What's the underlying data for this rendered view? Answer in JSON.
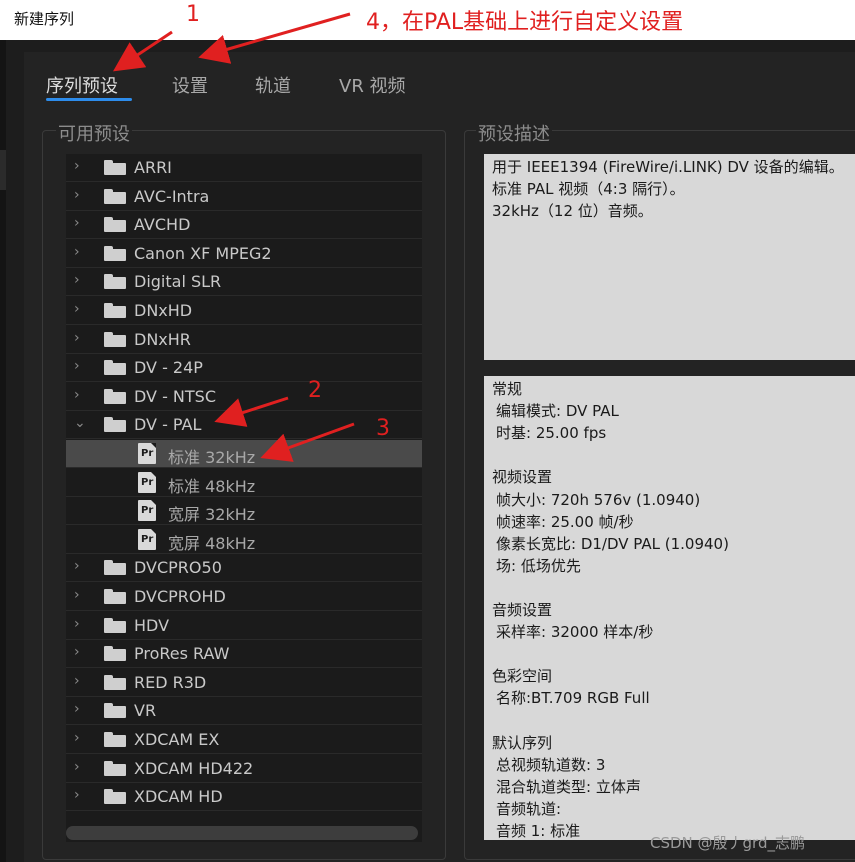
{
  "window": {
    "title": "新建序列"
  },
  "tabs": [
    {
      "label": "序列预设",
      "active": true
    },
    {
      "label": "设置",
      "active": false
    },
    {
      "label": "轨道",
      "active": false
    },
    {
      "label": "VR 视频",
      "active": false
    }
  ],
  "presets": {
    "section_label": "可用预设",
    "rows": [
      {
        "label": "ARRI",
        "type": "folder",
        "expanded": false
      },
      {
        "label": "AVC-Intra",
        "type": "folder",
        "expanded": false
      },
      {
        "label": "AVCHD",
        "type": "folder",
        "expanded": false
      },
      {
        "label": "Canon XF MPEG2",
        "type": "folder",
        "expanded": false
      },
      {
        "label": "Digital SLR",
        "type": "folder",
        "expanded": false
      },
      {
        "label": "DNxHD",
        "type": "folder",
        "expanded": false
      },
      {
        "label": "DNxHR",
        "type": "folder",
        "expanded": false
      },
      {
        "label": "DV - 24P",
        "type": "folder",
        "expanded": false
      },
      {
        "label": "DV - NTSC",
        "type": "folder",
        "expanded": false
      },
      {
        "label": "DV - PAL",
        "type": "folder",
        "expanded": true
      },
      {
        "label": "标准 32kHz",
        "type": "preset",
        "selected": true
      },
      {
        "label": "标准 48kHz",
        "type": "preset"
      },
      {
        "label": "宽屏 32kHz",
        "type": "preset"
      },
      {
        "label": "宽屏 48kHz",
        "type": "preset"
      },
      {
        "label": "DVCPRO50",
        "type": "folder",
        "expanded": false
      },
      {
        "label": "DVCPROHD",
        "type": "folder",
        "expanded": false
      },
      {
        "label": "HDV",
        "type": "folder",
        "expanded": false
      },
      {
        "label": "ProRes RAW",
        "type": "folder",
        "expanded": false
      },
      {
        "label": "RED R3D",
        "type": "folder",
        "expanded": false
      },
      {
        "label": "VR",
        "type": "folder",
        "expanded": false
      },
      {
        "label": "XDCAM EX",
        "type": "folder",
        "expanded": false
      },
      {
        "label": "XDCAM HD422",
        "type": "folder",
        "expanded": false
      },
      {
        "label": "XDCAM HD",
        "type": "folder",
        "expanded": false
      }
    ],
    "preset_icon_text": "Pr"
  },
  "description": {
    "section_label": "预设描述",
    "lines": [
      "用于 IEEE1394 (FireWire/i.LINK) DV 设备的编辑。",
      "标准 PAL 视频（4:3 隔行）。",
      "32kHz（12 位）音频。"
    ]
  },
  "info": {
    "lines": [
      {
        "text": "常规",
        "sub": false
      },
      {
        "text": "编辑模式: DV PAL",
        "sub": true
      },
      {
        "text": "时基: 25.00 fps",
        "sub": true
      },
      {
        "text": "",
        "sub": false
      },
      {
        "text": "视频设置",
        "sub": false
      },
      {
        "text": "帧大小: 720h 576v (1.0940)",
        "sub": true
      },
      {
        "text": "帧速率: 25.00  帧/秒",
        "sub": true
      },
      {
        "text": "像素长宽比: D1/DV PAL (1.0940)",
        "sub": true
      },
      {
        "text": "场: 低场优先",
        "sub": true
      },
      {
        "text": "",
        "sub": false
      },
      {
        "text": "音频设置",
        "sub": false
      },
      {
        "text": "采样率: 32000 样本/秒",
        "sub": true
      },
      {
        "text": "",
        "sub": false
      },
      {
        "text": "色彩空间",
        "sub": false
      },
      {
        "text": "名称:BT.709 RGB Full",
        "sub": true
      },
      {
        "text": "",
        "sub": false
      },
      {
        "text": "默认序列",
        "sub": false
      },
      {
        "text": "总视频轨道数: 3",
        "sub": true
      },
      {
        "text": "混合轨道类型:  立体声",
        "sub": true
      },
      {
        "text": "音频轨道:",
        "sub": true
      },
      {
        "text": "音频 1: 标准",
        "sub": true
      }
    ]
  },
  "annotations": {
    "n1": "1",
    "n4": "4，在PAL基础上进行自定义设置",
    "n2": "2",
    "n3": "3",
    "color": "#e02020"
  },
  "watermark": "CSDN @殷丿grd_志鹏",
  "colors": {
    "accent": "#2d8ceb",
    "background": "#232323",
    "selected_row": "#4a4a4a"
  }
}
